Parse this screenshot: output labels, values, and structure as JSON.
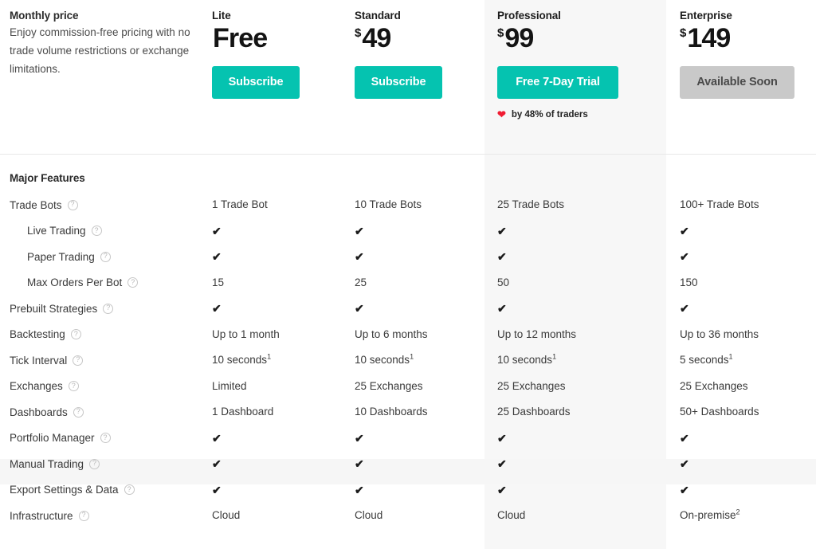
{
  "header": {
    "description": {
      "title": "Monthly price",
      "body": "Enjoy commission-free pricing with no trade volume restrictions or exchange limitations."
    },
    "plans": [
      {
        "name": "Lite",
        "currency": "",
        "price": "Free",
        "cta_label": "Subscribe",
        "cta_type": "primary",
        "featured": false
      },
      {
        "name": "Standard",
        "currency": "$",
        "price": "49",
        "cta_label": "Subscribe",
        "cta_type": "primary",
        "featured": false
      },
      {
        "name": "Professional",
        "currency": "$",
        "price": "99",
        "cta_label": "Free 7-Day Trial",
        "cta_type": "primary",
        "featured": true,
        "loved_note": "by 48% of traders",
        "loved_icon": "heart-icon"
      },
      {
        "name": "Enterprise",
        "currency": "$",
        "price": "149",
        "cta_label": "Available Soon",
        "cta_type": "disabled",
        "featured": false
      }
    ]
  },
  "features": {
    "section_title": "Major Features",
    "help_icon_glyph": "?",
    "check_glyph": "✔",
    "rows": [
      {
        "label": "Trade Bots",
        "indent": false,
        "help": true,
        "lite": "1 Trade Bot",
        "standard": "10 Trade Bots",
        "professional": "25 Trade Bots",
        "enterprise": "100+ Trade Bots"
      },
      {
        "label": "Live Trading",
        "indent": true,
        "help": true,
        "lite": "check",
        "standard": "check",
        "professional": "check",
        "enterprise": "check"
      },
      {
        "label": "Paper Trading",
        "indent": true,
        "help": true,
        "lite": "check",
        "standard": "check",
        "professional": "check",
        "enterprise": "check"
      },
      {
        "label": "Max Orders Per Bot",
        "indent": true,
        "help": true,
        "lite": "15",
        "standard": "25",
        "professional": "50",
        "enterprise": "150"
      },
      {
        "label": "Prebuilt Strategies",
        "indent": false,
        "help": true,
        "lite": "check",
        "standard": "check",
        "professional": "check",
        "enterprise": "check"
      },
      {
        "label": "Backtesting",
        "indent": false,
        "help": true,
        "lite": "Up to 1 month",
        "standard": "Up to 6 months",
        "professional": "Up to 12 months",
        "enterprise": "Up to 36 months"
      },
      {
        "label": "Tick Interval",
        "indent": false,
        "help": true,
        "lite": "10 seconds",
        "lite_sup": "1",
        "standard": "10 seconds",
        "standard_sup": "1",
        "professional": "10 seconds",
        "professional_sup": "1",
        "enterprise": "5 seconds",
        "enterprise_sup": "1"
      },
      {
        "label": "Exchanges",
        "indent": false,
        "help": true,
        "lite": "Limited",
        "standard": "25 Exchanges",
        "professional": "25 Exchanges",
        "enterprise": "25 Exchanges"
      },
      {
        "label": "Dashboards",
        "indent": false,
        "help": true,
        "lite": "1 Dashboard",
        "standard": "10 Dashboards",
        "professional": "25 Dashboards",
        "enterprise": "50+ Dashboards"
      },
      {
        "label": "Portfolio Manager",
        "indent": false,
        "help": true,
        "lite": "check",
        "standard": "check",
        "professional": "check",
        "enterprise": "check"
      },
      {
        "label": "Manual Trading",
        "indent": false,
        "help": true,
        "highlighted": true,
        "lite": "check",
        "standard": "check",
        "professional": "check",
        "enterprise": "check"
      },
      {
        "label": "Export Settings & Data",
        "indent": false,
        "help": true,
        "lite": "check",
        "standard": "check",
        "professional": "check",
        "enterprise": "check"
      },
      {
        "label": "Infrastructure",
        "indent": false,
        "help": true,
        "lite": "Cloud",
        "standard": "Cloud",
        "professional": "Cloud",
        "enterprise": "On-premise",
        "enterprise_sup": "2"
      }
    ]
  },
  "colors": {
    "accent": "#05c3b0",
    "disabled": "#c9c9c9",
    "heart": "#f01c32",
    "featured_band": "#f7f7f7",
    "row_highlight": "#f6f6f6",
    "divider": "#e8e8e8"
  }
}
